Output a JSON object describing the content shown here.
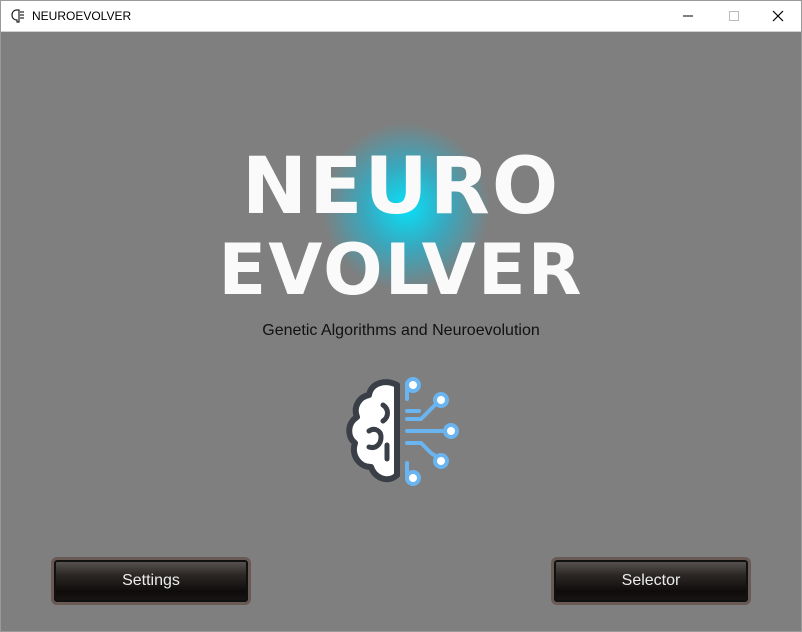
{
  "window": {
    "title": "NEUROEVOLVER",
    "controls": [
      "minimize",
      "maximize",
      "close"
    ]
  },
  "main": {
    "logo_line1": "NEURO",
    "logo_line2": "EVOLVER",
    "subtitle": "Genetic Algorithms and Neuroevolution",
    "logo_icon": "brain-circuit-icon",
    "glow_color": "#00e5ff"
  },
  "buttons": {
    "settings_label": "Settings",
    "selector_label": "Selector"
  },
  "colors": {
    "background": "#7f7f7f",
    "circuit_blue": "#6ab4f0",
    "brain_outline": "#3a3f47"
  }
}
